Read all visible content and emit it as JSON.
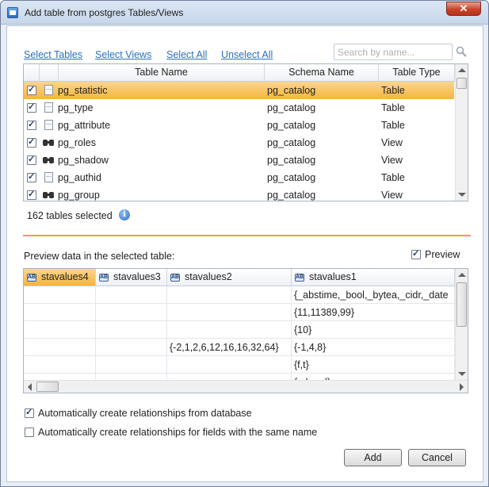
{
  "window": {
    "title": "Add table from postgres Tables/Views",
    "close_glyph": "✕"
  },
  "toolbar": {
    "select_tables": "Select Tables",
    "select_views": "Select Views",
    "select_all": "Select All",
    "unselect_all": "Unselect All",
    "search_placeholder": "Search by name..."
  },
  "tables_grid": {
    "columns": [
      "Table Name",
      "Schema Name",
      "Table Type"
    ],
    "rows": [
      {
        "checked": true,
        "icon": "table-icon",
        "name": "pg_statistic",
        "schema": "pg_catalog",
        "type": "Table",
        "selected": true
      },
      {
        "checked": true,
        "icon": "table-icon",
        "name": "pg_type",
        "schema": "pg_catalog",
        "type": "Table",
        "selected": false
      },
      {
        "checked": true,
        "icon": "table-icon",
        "name": "pg_attribute",
        "schema": "pg_catalog",
        "type": "Table",
        "selected": false
      },
      {
        "checked": true,
        "icon": "view-icon",
        "name": "pg_roles",
        "schema": "pg_catalog",
        "type": "View",
        "selected": false
      },
      {
        "checked": true,
        "icon": "view-icon",
        "name": "pg_shadow",
        "schema": "pg_catalog",
        "type": "View",
        "selected": false
      },
      {
        "checked": true,
        "icon": "table-icon",
        "name": "pg_authid",
        "schema": "pg_catalog",
        "type": "Table",
        "selected": false
      },
      {
        "checked": true,
        "icon": "view-icon",
        "name": "pg_group",
        "schema": "pg_catalog",
        "type": "View",
        "selected": false
      }
    ]
  },
  "status": {
    "selected_count_text": "162 tables selected",
    "info_glyph": "i"
  },
  "preview": {
    "label": "Preview data in the selected table:",
    "checkbox_label": "Preview",
    "checkbox_checked": true,
    "column_icon_text": "AB",
    "columns": [
      "stavalues4",
      "stavalues3",
      "stavalues2",
      "stavalues1"
    ],
    "rows": [
      [
        "",
        "",
        "",
        "{_abstime,_bool,_bytea,_cidr,_date"
      ],
      [
        "",
        "",
        "",
        "{11,11389,99}"
      ],
      [
        "",
        "",
        "",
        "{10}"
      ],
      [
        "",
        "",
        "{-2,1,2,6,12,16,16,32,64}",
        "{-1,4,8}"
      ],
      [
        "",
        "",
        "",
        "{f,t}"
      ],
      [
        "",
        "",
        "",
        "{a,b,c,d}"
      ]
    ]
  },
  "options": {
    "auto_rel_db_label": "Automatically create relationships from database",
    "auto_rel_db_checked": true,
    "auto_rel_name_label": "Automatically create relationships for fields with the same name",
    "auto_rel_name_checked": false
  },
  "buttons": {
    "add": "Add",
    "cancel": "Cancel"
  }
}
